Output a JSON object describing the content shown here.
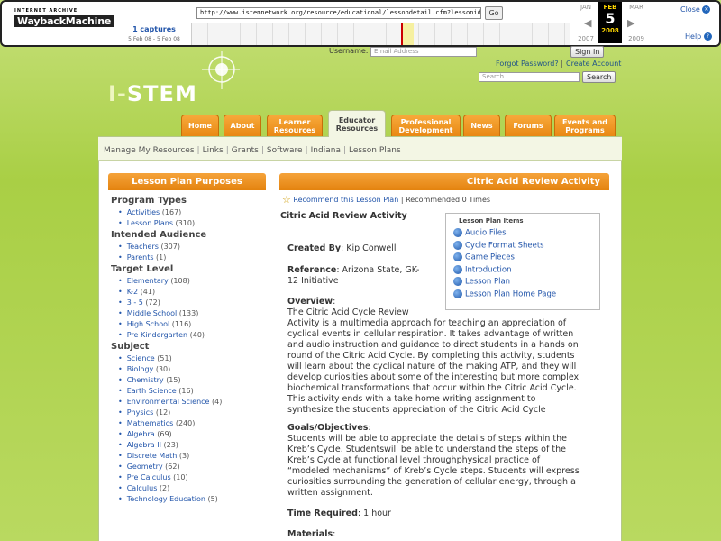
{
  "wayback": {
    "logo_line1": "INTERNET ARCHIVE",
    "logo_line2": "WaybackMachine",
    "url": "http://www.istemnetwork.org/resource/educational/lessondetail.cfm?lessonid=61",
    "go_label": "Go",
    "captures": "1 captures",
    "capture_range": "5 Feb 08 - 5 Feb 08",
    "prev_month": "JAN",
    "cur_month": "FEB",
    "next_month": "MAR",
    "cur_day": "5",
    "prev_year": "2007",
    "cur_year": "2008",
    "next_year": "2009",
    "close": "Close",
    "help": "Help"
  },
  "header": {
    "logo_prefix": "I-",
    "logo_main": "STEM",
    "username_label": "Username:",
    "email_placeholder": "Email Address",
    "signin": "Sign In",
    "forgot": "Forgot Password?",
    "sep": "|",
    "create": "Create Account",
    "search_placeholder": "Search",
    "search_button": "Search"
  },
  "tabs": [
    {
      "label": "Home"
    },
    {
      "label": "About"
    },
    {
      "label": "Learner Resources"
    },
    {
      "label": "Educator Resources"
    },
    {
      "label": "Professional Development"
    },
    {
      "label": "News"
    },
    {
      "label": "Forums"
    },
    {
      "label": "Events and Programs"
    }
  ],
  "subnav": [
    "Manage My Resources",
    "Links",
    "Grants",
    "Software",
    "Indiana",
    "Lesson Plans"
  ],
  "left": {
    "title": "Lesson Plan Purposes",
    "groups": [
      {
        "name": "Program Types",
        "items": [
          {
            "label": "Activities",
            "count": "(167)"
          },
          {
            "label": "Lesson Plans",
            "count": "(310)"
          }
        ]
      },
      {
        "name": "Intended Audience",
        "items": [
          {
            "label": "Teachers",
            "count": "(307)"
          },
          {
            "label": "Parents",
            "count": "(1)"
          }
        ]
      },
      {
        "name": "Target Level",
        "items": [
          {
            "label": "Elementary",
            "count": "(108)"
          },
          {
            "label": "K-2",
            "count": "(41)"
          },
          {
            "label": "3 - 5",
            "count": "(72)"
          },
          {
            "label": "Middle School",
            "count": "(133)"
          },
          {
            "label": "High School",
            "count": "(116)"
          },
          {
            "label": "Pre Kindergarten",
            "count": "(40)"
          }
        ]
      },
      {
        "name": "Subject",
        "items": [
          {
            "label": "Science",
            "count": "(51)"
          },
          {
            "label": "Biology",
            "count": "(30)"
          },
          {
            "label": "Chemistry",
            "count": "(15)"
          },
          {
            "label": "Earth Science",
            "count": "(16)"
          },
          {
            "label": "Environmental Science",
            "count": "(4)"
          },
          {
            "label": "Physics",
            "count": "(12)"
          },
          {
            "label": "Mathematics",
            "count": "(240)"
          },
          {
            "label": "Algebra",
            "count": "(69)"
          },
          {
            "label": "Algebra II",
            "count": "(23)"
          },
          {
            "label": "Discrete Math",
            "count": "(3)"
          },
          {
            "label": "Geometry",
            "count": "(62)"
          },
          {
            "label": "Pre Calculus",
            "count": "(10)"
          },
          {
            "label": "Calculus",
            "count": "(2)"
          },
          {
            "label": "Technology Education",
            "count": "(5)"
          }
        ]
      }
    ]
  },
  "main": {
    "head": "Citric Acid Review Activity",
    "recommend": "Recommend this Lesson Plan",
    "recommended": "| Recommended 0 Times",
    "title": "Citric Acid Review Activity",
    "items_title": "Lesson Plan Items",
    "items": [
      "Audio Files",
      "Cycle Format Sheets",
      "Game Pieces",
      "Introduction",
      "Lesson Plan",
      "Lesson Plan Home Page"
    ],
    "created_label": "Created By",
    "created_value": ": Kip Conwell",
    "reference_label": "Reference",
    "reference_value_1": ": Arizona State, GK-",
    "reference_value_2": "12 Initiative",
    "overview_label": "Overview",
    "overview_lines": [
      "The Citric Acid Cycle Review",
      "Activity is a multimedia approach for teaching an appreciation of",
      "cyclical events in cellular respiration. It takes advantage of written",
      "and audio instruction and guidance to direct students in a hands on",
      "round of the Citric Acid Cycle. By completing this activity, students",
      "will learn about the cyclical nature of the making ATP, and they will",
      "develop curiosities about some of the interesting but more complex",
      "biochemical transformations that occur within the Citric Acid Cycle.",
      "This activity ends with a take home writing assignment to",
      "synthesize the students appreciation of the Citric Acid Cycle"
    ],
    "goals_label": "Goals/Objectives",
    "goals_lines": [
      "Students will be able to appreciate the details of steps within the",
      "Kreb’s Cycle. Studentswill be able to understand the steps of the",
      "Kreb’s Cycle at functional level throughphysical practice of",
      "“modeled mechanisms” of Kreb’s Cycle steps. Students will express",
      "curiosities surrounding the generation of cellular energy, through a",
      "written assignment."
    ],
    "time_label": "Time Required",
    "time_value": ": 1 hour",
    "materials_label": "Materials",
    "colon": ":"
  }
}
